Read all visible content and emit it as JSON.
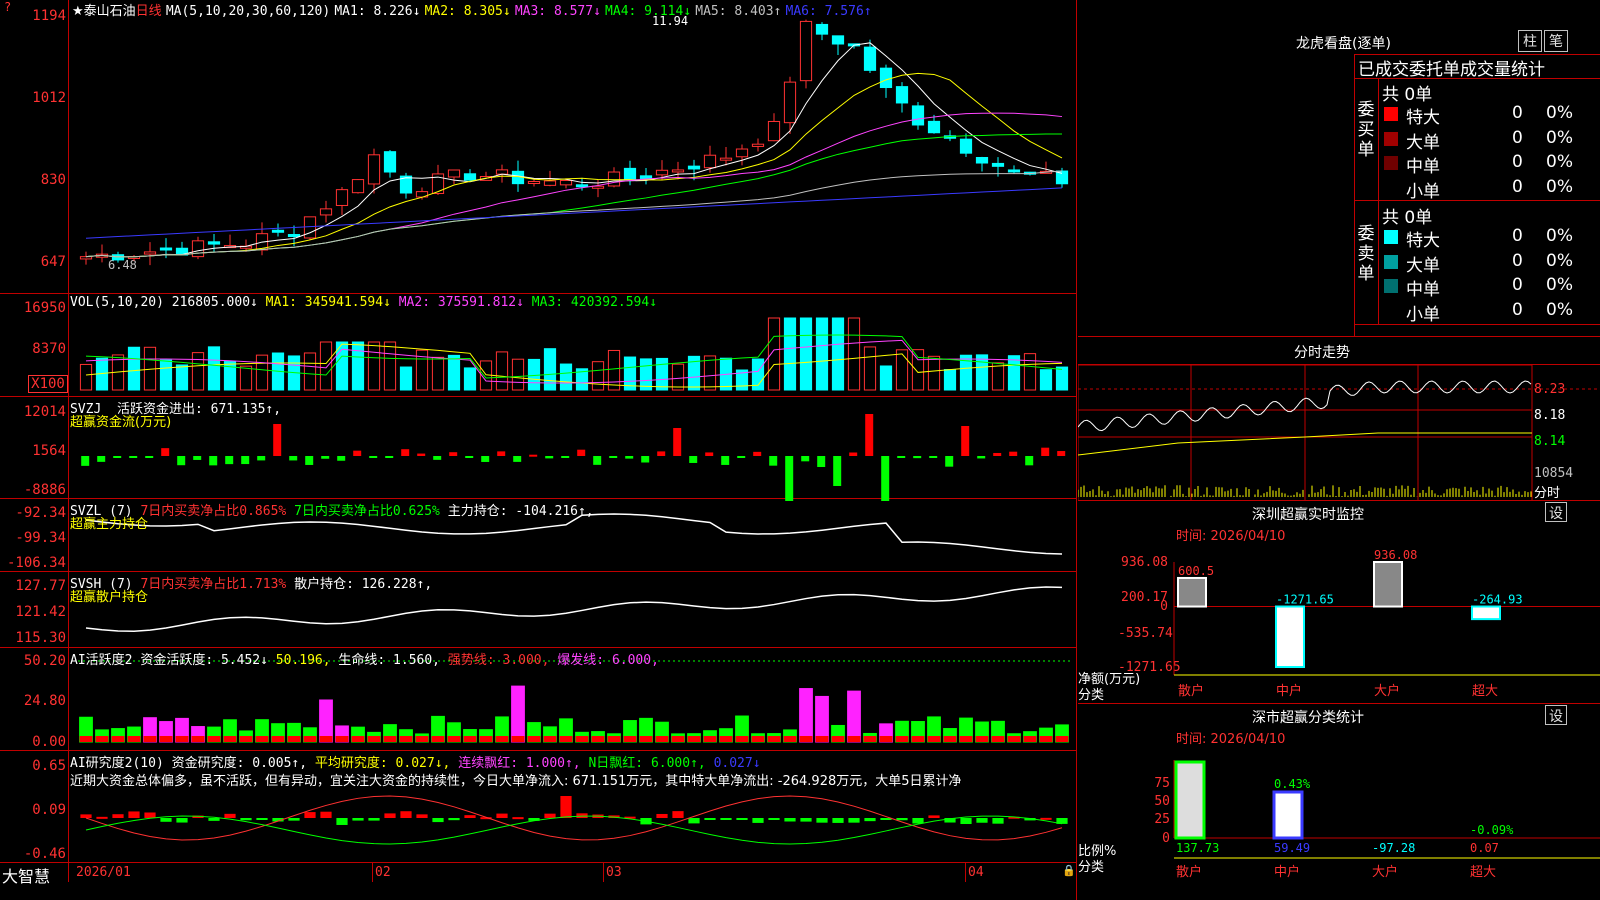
{
  "k": {
    "star": "★",
    "name": "泰山石油",
    "period": "日线",
    "ma_params": "MA(5,10,20,30,60,120)",
    "ma1": "MA1: 8.226↓",
    "ma2": "MA2: 8.305↓",
    "ma3": "MA3: 8.577↓",
    "ma4": "MA4: 9.114↓",
    "ma5": "MA5: 8.403↑",
    "ma6": "MA6: 7.576↑",
    "ax": [
      "1194",
      "1012",
      "830",
      "647"
    ],
    "hi": "11.94",
    "lo": "6.48"
  },
  "vol": {
    "title": "VOL(5,10,20)",
    "v": "216805.000↓",
    "ma1": "MA1: 345941.594↓",
    "ma2": "MA2: 375591.812↓",
    "ma3": "MA3: 420392.594↓",
    "ax": [
      "16950",
      "8370"
    ],
    "unit": "X100"
  },
  "svzj": {
    "name": "SVZJ",
    "label": "活跃资金进出: 671.135↑,",
    "sub": "超赢资金流(万元)",
    "ax": [
      "12014",
      "1564",
      "-8886"
    ]
  },
  "svzl": {
    "name": "SVZL (7)",
    "a": "7日内买卖净占比0.865%",
    "b": "7日内买卖净占比0.625%",
    "c": "主力持仓: -104.216↑,",
    "sub": "超赢主力持仓",
    "ax": [
      "-92.34",
      "-99.34",
      "-106.34"
    ]
  },
  "svsh": {
    "name": "SVSH (7)",
    "a": "7日内买卖净占比1.713%",
    "b": "散户持仓: 126.228↑,",
    "sub": "超赢散户持仓",
    "ax": [
      "127.77",
      "121.42",
      "115.30"
    ]
  },
  "ai": {
    "name": "AI活跃度2",
    "a": "资金活跃度: 5.452↓",
    "b": "50.196,",
    "c": "生命线: 1.560,",
    "d": "强势线: 3.000,",
    "e": "爆发线: 6.000,",
    "ax": [
      "50.20",
      "24.80",
      "0.00"
    ]
  },
  "air": {
    "name": "AI研究度2(10)",
    "a": "资金研究度: 0.005↑,",
    "b": "平均研究度: 0.027↓,",
    "c": "连续飘红: 1.000↑,",
    "d": "N日飘红: 6.000↑,",
    "e": "0.027↓",
    "note": "近期大资金总体偏多，虽不活跃，但有异动，宜关注大资金的持续性，今日大单净流入: 671.151万元，其中特大单净流出: -264.928万元，大单5日累计净",
    "ax": [
      "0.65",
      "0.09",
      "-0.46"
    ]
  },
  "dates": [
    "2026/01",
    "02",
    "03",
    "04"
  ],
  "brand": "大智慧",
  "lh": {
    "title": "龙虎看盘(逐单)",
    "btn1": "柱",
    "btn2": "笔",
    "header": "已成交委托单成交量统计",
    "buy": {
      "side": "委买单",
      "total": "共 0单",
      "rows": [
        {
          "n": "特大",
          "v": "0",
          "p": "0%",
          "c": "#ff0000"
        },
        {
          "n": "大单",
          "v": "0",
          "p": "0%",
          "c": "#a00000"
        },
        {
          "n": "中单",
          "v": "0",
          "p": "0%",
          "c": "#700000"
        },
        {
          "n": "小单",
          "v": "0",
          "p": "0%",
          "c": ""
        }
      ]
    },
    "sell": {
      "side": "委卖单",
      "total": "共 0单",
      "rows": [
        {
          "n": "特大",
          "v": "0",
          "p": "0%",
          "c": "#00ffff"
        },
        {
          "n": "大单",
          "v": "0",
          "p": "0%",
          "c": "#00a0a0"
        },
        {
          "n": "中单",
          "v": "0",
          "p": "0%",
          "c": "#007070"
        },
        {
          "n": "小单",
          "v": "0",
          "p": "0%",
          "c": ""
        }
      ]
    }
  },
  "fs": {
    "title": "分时走势",
    "ax": [
      "8.23",
      "8.18",
      "8.14"
    ],
    "vol": "10854",
    "unit": "分时"
  },
  "sz1": {
    "title": "深圳超赢实时监控",
    "btn": "设",
    "time": "时间: 2026/04/10",
    "ax": [
      "936.08",
      "200.17",
      "0",
      "-535.74",
      "-1271.65"
    ],
    "ylabel": "净额(万元)",
    "xlabel": "分类",
    "cats": [
      "散户",
      "中户",
      "大户",
      "超大"
    ],
    "vals": [
      "600.5",
      "-1271.65",
      "936.08",
      "-264.93"
    ]
  },
  "sz2": {
    "title": "深市超赢分类统计",
    "btn": "设",
    "time": "时间: 2026/04/10",
    "ax": [
      "75",
      "50",
      "25",
      "0"
    ],
    "ylabel": "比例%",
    "xlabel": "分类",
    "cats": [
      "散户",
      "中户",
      "大户",
      "超大"
    ],
    "tops": [
      "",
      "0.43%",
      "",
      "-0.09%"
    ],
    "vals": [
      "137.73",
      "59.49",
      "-97.28",
      "0.07"
    ]
  },
  "chart_data": {
    "type": "bar",
    "title": "深圳超赢实时监控",
    "categories": [
      "散户",
      "中户",
      "大户",
      "超大"
    ],
    "values": [
      600.5,
      -1271.65,
      936.08,
      -264.93
    ],
    "ylabel": "净额(万元)",
    "ylim": [
      -1271.65,
      936.08
    ]
  }
}
